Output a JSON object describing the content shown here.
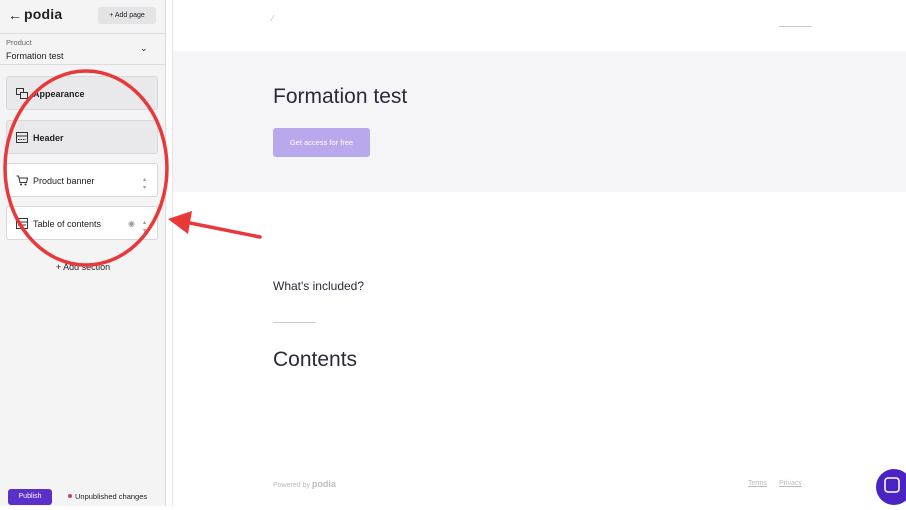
{
  "sidebar": {
    "brand": "podia",
    "add_page": "+ Add page",
    "product_select": {
      "kicker": "Product",
      "name": "Formation test"
    },
    "sections": [
      {
        "label": "Appearance"
      },
      {
        "label": "Header"
      },
      {
        "label": "Product banner"
      },
      {
        "label": "Table of contents"
      }
    ],
    "add_section": "+ Add section",
    "publish": "Publish",
    "unpublished": "Unpublished changes"
  },
  "preview": {
    "title": "Formation test",
    "cta": "Get access for free",
    "included": "What's included?",
    "contents": "Contents",
    "footer": {
      "powered_by": "Powered by",
      "brand": "podia",
      "terms": "Terms",
      "privacy": "Privacy"
    }
  },
  "colors": {
    "accent": "#5b2fc9",
    "cta": "#b9a8ec",
    "annotation": "#e8383a"
  }
}
